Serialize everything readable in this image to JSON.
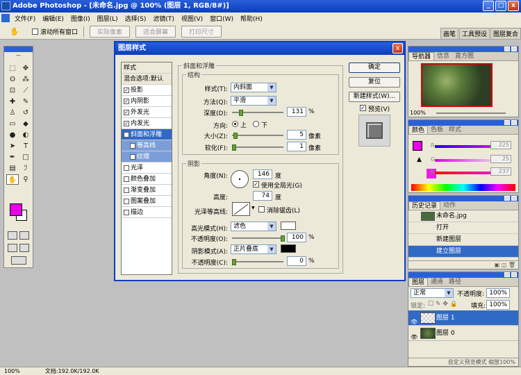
{
  "window": {
    "title": "Adobe Photoshop - [未命名.jpg @ 100% (图层 1, RGB/8#)]",
    "min": "_",
    "max": "□",
    "close": "x"
  },
  "menu": [
    "文件(F)",
    "编辑(E)",
    "图像(I)",
    "图层(L)",
    "选择(S)",
    "滤镜(T)",
    "视图(V)",
    "窗口(W)",
    "帮助(H)"
  ],
  "options": {
    "scroll_all": "滚动所有窗口",
    "actual_pixels": "实际像素",
    "fit_screen": "适合屏幕",
    "print_size": "打印尺寸"
  },
  "well_tabs": [
    "画笔",
    "工具预设",
    "图层复合"
  ],
  "dialog": {
    "title": "图层样式",
    "close": "x",
    "styles_list": [
      {
        "label": "样式",
        "type": "head"
      },
      {
        "label": "混合选项:默认",
        "type": "head"
      },
      {
        "label": "投影",
        "checked": "✓"
      },
      {
        "label": "内阴影",
        "checked": "✓"
      },
      {
        "label": "外发光",
        "checked": "✓"
      },
      {
        "label": "内发光",
        "checked": "✓"
      },
      {
        "label": "斜面和浮雕",
        "checked": "✓",
        "active": true
      },
      {
        "label": "等高线",
        "checked": "",
        "sub": true
      },
      {
        "label": "纹理",
        "checked": "",
        "sub": true
      },
      {
        "label": "光泽",
        "checked": ""
      },
      {
        "label": "颜色叠加",
        "checked": ""
      },
      {
        "label": "渐变叠加",
        "checked": ""
      },
      {
        "label": "图案叠加",
        "checked": ""
      },
      {
        "label": "描边",
        "checked": ""
      }
    ],
    "section_title": "斜面和浮雕",
    "structure": {
      "label": "结构",
      "style_label": "样式(T):",
      "style_value": "内斜面",
      "technique_label": "方法(Q):",
      "technique_value": "平滑",
      "depth_label": "深度(D):",
      "depth_value": "131",
      "depth_unit": "%",
      "direction_label": "方向:",
      "dir_up": "上",
      "dir_down": "下",
      "size_label": "大小(Z):",
      "size_value": "5",
      "size_unit": "像素",
      "soften_label": "软化(F):",
      "soften_value": "1",
      "soften_unit": "像素"
    },
    "shading": {
      "label": "阴影",
      "angle_label": "角度(N):",
      "angle_value": "146",
      "angle_unit": "度",
      "global_light": "使用全局光(G)",
      "altitude_label": "高度:",
      "altitude_value": "74",
      "altitude_unit": "度",
      "gloss_label": "光泽等高线:",
      "antialias": "消除锯齿(L)",
      "highlight_mode_label": "高光模式(H):",
      "highlight_mode": "滤色",
      "highlight_opacity_label": "不透明度(O):",
      "highlight_opacity": "100",
      "highlight_opacity_unit": "%",
      "shadow_mode_label": "阴影模式(A):",
      "shadow_mode": "正片叠底",
      "shadow_opacity_label": "不透明度(C):",
      "shadow_opacity": "0",
      "shadow_opacity_unit": "%"
    },
    "buttons": {
      "ok": "确定",
      "reset": "复位",
      "new_style": "新建样式(W)...",
      "preview": "预览(V)"
    }
  },
  "navigator": {
    "tabs": [
      "导航器",
      "信息",
      "直方图"
    ],
    "zoom": "100%"
  },
  "color": {
    "tabs": [
      "颜色",
      "色板",
      "样式"
    ],
    "r_label": "R",
    "g_label": "G",
    "b_label": "B",
    "r": "225",
    "g": "25",
    "b": "237"
  },
  "history": {
    "tabs": [
      "历史记录",
      "动作"
    ],
    "doc": "未命名.jpg",
    "items": [
      "打开",
      "新建图层",
      "建立图层"
    ]
  },
  "layers": {
    "tabs": [
      "图层",
      "通道",
      "路径"
    ],
    "blend": "正常",
    "opacity_label": "不透明度:",
    "opacity": "100%",
    "lock_label": "锁定:",
    "fill_label": "填充:",
    "fill": "100%",
    "items": [
      "图层 1",
      "图层 0"
    ],
    "footer": "自定义预览模式  缩放100%"
  },
  "status": {
    "zoom": "100%",
    "doc": "文档:192.0K/192.0K"
  },
  "colors": {
    "foreground": "#e800e8",
    "background": "#ffffff",
    "selection": "#316ac5"
  }
}
